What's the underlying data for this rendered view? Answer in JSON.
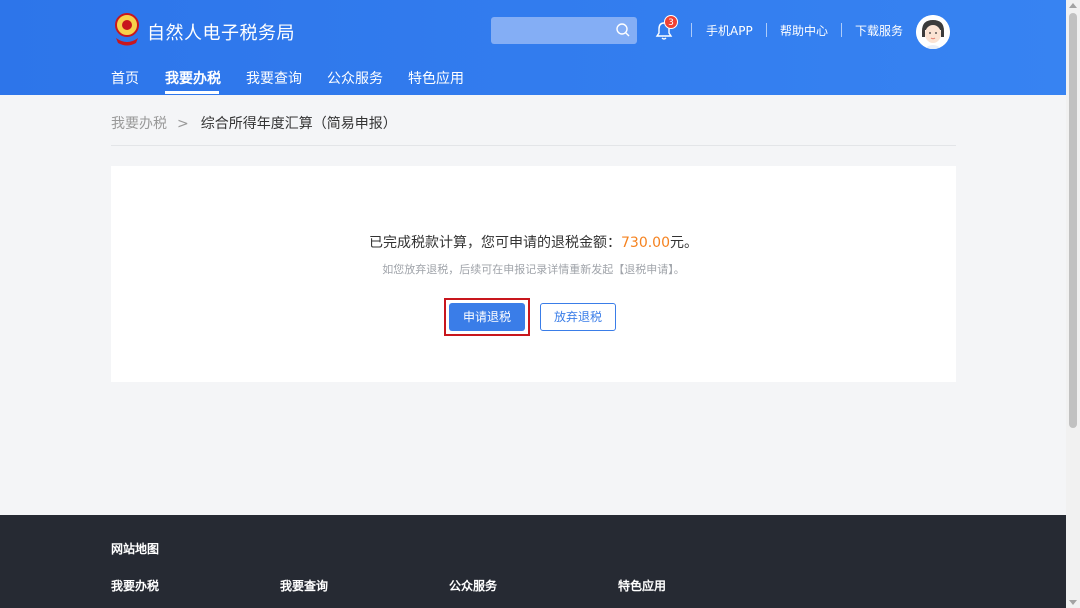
{
  "header": {
    "site_title": "自然人电子税务局",
    "search": {
      "placeholder": ""
    },
    "notifications": {
      "count": "3"
    },
    "links": [
      "手机APP",
      "帮助中心",
      "下载服务"
    ],
    "brand_color": "#2d75ea"
  },
  "nav": {
    "items": [
      "首页",
      "我要办税",
      "我要查询",
      "公众服务",
      "特色应用"
    ],
    "active": "我要办税"
  },
  "breadcrumb": {
    "parent": "我要办税",
    "current": "综合所得年度汇算（简易申报）"
  },
  "result": {
    "message_prefix": "已完成税款计算，您可申请的退税金额：",
    "amount": "730.00",
    "message_suffix": "元。",
    "note": "如您放弃退税，后续可在申报记录详情重新发起【退税申请】。",
    "apply_button": "申请退税",
    "abandon_button": "放弃退税",
    "amount_color": "#f5821f",
    "highlight_color": "#c8161d"
  },
  "footer": {
    "title": "网站地图",
    "columns": [
      "我要办税",
      "我要查询",
      "公众服务",
      "特色应用"
    ]
  }
}
